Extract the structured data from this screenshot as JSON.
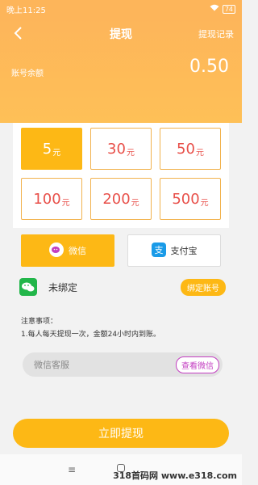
{
  "status": {
    "time": "晚上11:25",
    "battery": "74"
  },
  "nav": {
    "title": "提现",
    "records": "提现记录"
  },
  "balance": {
    "label": "账号余额",
    "value": "0.50"
  },
  "amounts": [
    {
      "value": "5",
      "unit": "元",
      "selected": true
    },
    {
      "value": "30",
      "unit": "元"
    },
    {
      "value": "50",
      "unit": "元"
    },
    {
      "value": "100",
      "unit": "元"
    },
    {
      "value": "200",
      "unit": "元"
    },
    {
      "value": "500",
      "unit": "元"
    }
  ],
  "payment": {
    "wechat_label": "微信",
    "alipay_label": "支付宝"
  },
  "binding": {
    "status": "未绑定",
    "button": "绑定账号"
  },
  "notice": {
    "title": "注意事项：",
    "line1": "1.每人每天提现一次，金额24小时内到账。"
  },
  "service": {
    "label": "微信客服",
    "button": "查看微信"
  },
  "submit": {
    "label": "立即提现"
  },
  "watermark": {
    "text": "318首码网 www.e318.com"
  },
  "colors": {
    "accent": "#fdb815",
    "header": "#fdb55a",
    "price": "#e8504a",
    "wechat": "#22b64a",
    "alipay": "#1a9be8",
    "service": "#c33ec1"
  }
}
